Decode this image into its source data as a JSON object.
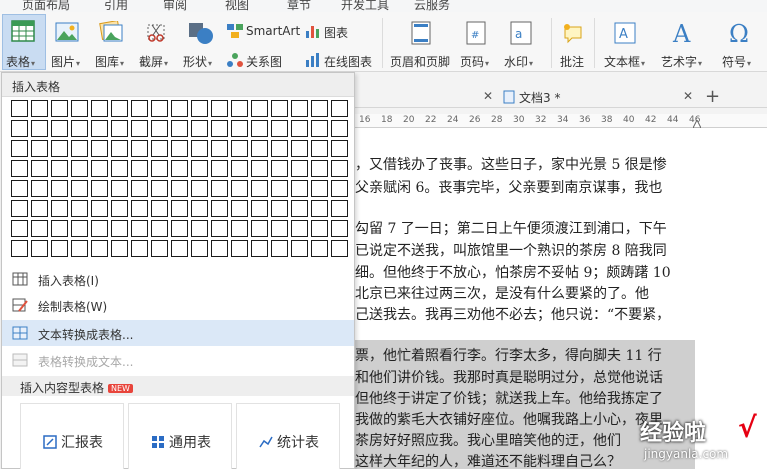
{
  "menu_tabs": [
    "页面布局",
    "引用",
    "审阅",
    "视图",
    "章节",
    "开发工具",
    "云服务"
  ],
  "ribbon": {
    "table": "表格",
    "picture": "图片",
    "gallery": "图库",
    "screenshot": "截屏",
    "shape": "形状",
    "smartart": "SmartArt",
    "chart": "图表",
    "relation": "关系图",
    "online_chart": "在线图表",
    "header_footer": "页眉和页脚",
    "page_number": "页码",
    "watermark": "水印",
    "comment": "批注",
    "textbox": "文本框",
    "wordart": "艺术字",
    "symbol": "符号"
  },
  "doc_tabs": {
    "doc3": "文档3 *",
    "add": "+"
  },
  "ruler_numbers": [
    "16",
    "18",
    "20",
    "22",
    "24",
    "26",
    "28",
    "30",
    "32",
    "34",
    "36",
    "38",
    "40",
    "42",
    "44",
    "46"
  ],
  "document_lines": [
    "，又借钱办了丧事。这些日子，家中光景 5 很是惨",
    "父亲赋闲 6。丧事完毕，父亲要到南京谋事，我也",
    "",
    "勾留 7 了一日；第二日上午便须渡江到浦口，下午",
    "已说定不送我，叫旅馆里一个熟识的茶房 8 陪我同",
    "细。但他终于不放心，怕茶房不妥帖 9；颇踌躇 10",
    "北京已来往过两三次，是没有什么要紧的了。他",
    "己送我去。我再三劝他不必去；他只说：“不要紧，",
    "",
    "票，他忙着照看行李。行李太多，得向脚夫 11 行",
    "和他们讲价钱。我那时真是聪明过分，总觉他说话",
    "但他终于讲定了价钱；就送我上车。他给我拣定了",
    "我做的紫毛大衣铺好座位。他嘱我路上小心，夜里",
    "茶房好好照应我。我心里暗笑他的迂，他们",
    "这样大年纪的人，难道还不能料理自己么？"
  ],
  "dropdown": {
    "title": "插入表格",
    "grid_rows": 8,
    "grid_cols": 17,
    "items": [
      {
        "label": "插入表格(I)",
        "icon": "table-icon",
        "state": "normal"
      },
      {
        "label": "绘制表格(W)",
        "icon": "pencil-table-icon",
        "state": "normal"
      },
      {
        "label": "文本转换成表格...",
        "icon": "text-to-table-icon",
        "state": "hover"
      },
      {
        "label": "表格转换成文本...",
        "icon": "table-to-text-icon",
        "state": "disabled"
      }
    ],
    "section2_title": "插入内容型表格",
    "new_badge": "NEW",
    "cards": [
      "汇报表",
      "通用表",
      "统计表"
    ]
  },
  "watermark": {
    "text": "经验啦",
    "url": "jingyanla.com",
    "tick": "√"
  },
  "colors": {
    "accent_blue": "#2b6cc4",
    "hover": "#dbe8f7",
    "active_button": "#c9dcf2",
    "selection": "#cfcfcf",
    "badge_red": "#e8443b"
  }
}
